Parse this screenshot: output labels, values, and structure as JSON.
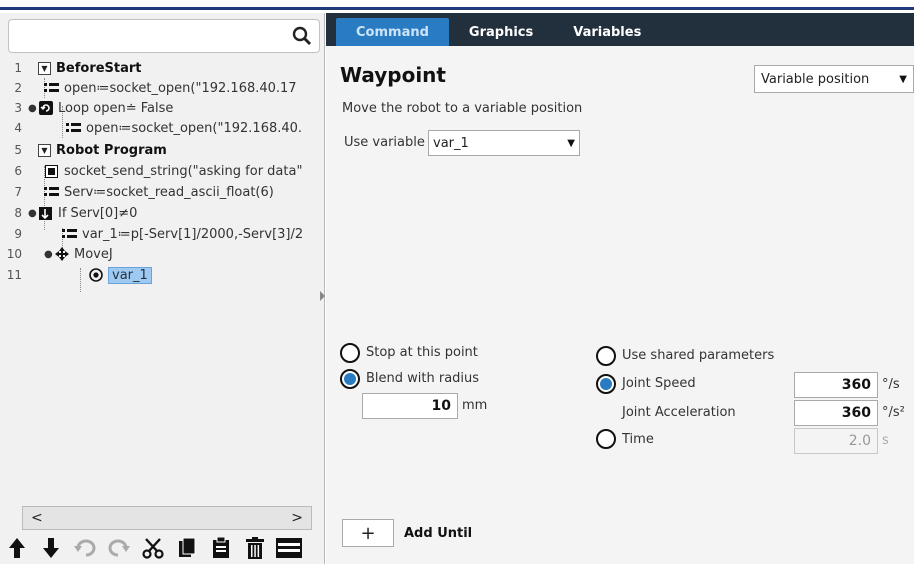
{
  "tree": {
    "rows": [
      {
        "num": "1",
        "text": "BeforeStart"
      },
      {
        "num": "2",
        "text": "open≔socket_open(\"192.168.40.17"
      },
      {
        "num": "3",
        "text": "Loop open≐ False"
      },
      {
        "num": "4",
        "text": "open≔socket_open(\"192.168.40."
      },
      {
        "num": "5",
        "text": "Robot Program"
      },
      {
        "num": "6",
        "text": "socket_send_string(\"asking for data\""
      },
      {
        "num": "7",
        "text": "Serv≔socket_read_ascii_float(6)"
      },
      {
        "num": "8",
        "text": "If Serv[0]≠0"
      },
      {
        "num": "9",
        "text": "var_1≔p[-Serv[1]/2000,-Serv[3]/2"
      },
      {
        "num": "10",
        "text": "MoveJ"
      },
      {
        "num": "11",
        "text": "var_1"
      }
    ]
  },
  "scrollbar": {
    "left": "<",
    "right": ">"
  },
  "tabs": [
    {
      "label": "Command",
      "active": true
    },
    {
      "label": "Graphics",
      "active": false
    },
    {
      "label": "Variables",
      "active": false
    }
  ],
  "command": {
    "title": "Waypoint",
    "position_mode": "Variable position",
    "subtitle": "Move the robot to a variable position",
    "use_variable_label": "Use variable",
    "use_variable_value": "var_1",
    "stop_label": "Stop at this point",
    "blend_label": "Blend with radius",
    "blend_value": "10",
    "blend_unit": "mm",
    "shared_label": "Use shared parameters",
    "joint_speed_label": "Joint Speed",
    "joint_speed_value": "360",
    "joint_speed_unit": "°/s",
    "joint_accel_label": "Joint Acceleration",
    "joint_accel_value": "360",
    "joint_accel_unit": "°/s²",
    "time_label": "Time",
    "time_value": "2.0",
    "time_unit": "s",
    "add_until_label": "Add Until",
    "add_until_symbol": "+"
  },
  "colors": {
    "tabbar": "#222f3d",
    "active_tab": "#2a7cc2",
    "selection": "#9ec9f0"
  }
}
